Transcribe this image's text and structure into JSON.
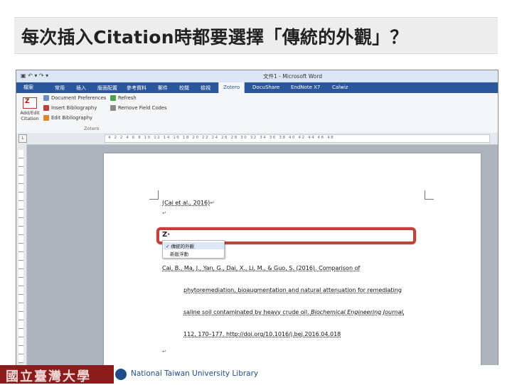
{
  "slide": {
    "title": "每次插入Citation時都要選擇「傳統的外觀」？"
  },
  "window": {
    "title": "文件1 - Microsoft Word",
    "quick_access": "▣ ↶ ▾ ↷ ▾"
  },
  "ribbon": {
    "file_tab": "檔案",
    "tabs": [
      "常用",
      "插入",
      "版面配置",
      "參考資料",
      "郵件",
      "校閱",
      "檢視",
      "Zotero",
      "DocuShare",
      "EndNote X7",
      "Calwiz"
    ],
    "active_tab": "Zotero",
    "big_button_label": "Add/Edit Citation",
    "commands": {
      "document_preferences": "Document Preferences",
      "insert_bibliography": "Insert Bibliography",
      "edit_bibliography": "Edit Bibliography",
      "refresh": "Refresh",
      "remove_field_codes": "Remove Field Codes"
    },
    "group_label": "Zotero",
    "colors": {
      "tab_bar": "#2b579a",
      "accent": "#c0413b"
    }
  },
  "ruler": {
    "corner": "L",
    "numbers": "4 2 2 4 6 8 10 12 14 16 18 20 22 24 26 28 30 32 34 36 38 40 42 44 46 48"
  },
  "document": {
    "citation": "(Cai et al., 2016)",
    "zotero_bar_mark": "Z·",
    "dropdown": {
      "checked_item": "✓ 傳統的外觀",
      "item_2": "新版浮動"
    },
    "reference_lines": [
      "Cai, B., Ma, J., Yan, G., Dai, X., Li, M., & Guo, S. (2016). Comparison of",
      "phytoremediation, bioaugmentation and natural attenuation for remediating",
      "saline soil contaminated by heavy crude oil.",
      "Biochemical Engineering Journal,",
      "112, 170–177. http://doi.org/10.1016/j.bej.2016.04.018"
    ],
    "paragraph_mark": "↵"
  },
  "footer": {
    "stamp_text": "國立臺灣大學",
    "library_name": "National Taiwan University Library"
  }
}
